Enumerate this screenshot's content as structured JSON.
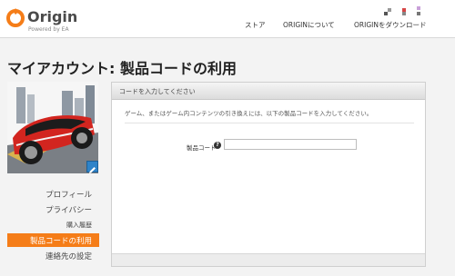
{
  "brand": {
    "name": "Origin",
    "tagline": "Powered by EA"
  },
  "nav": {
    "items": [
      {
        "label": "ストア"
      },
      {
        "label": "ORIGINについて"
      },
      {
        "label": "ORIGINをダウンロード"
      }
    ]
  },
  "page": {
    "title": "マイアカウント: 製品コードの利用"
  },
  "menu": {
    "items": [
      {
        "label": "プロフィール"
      },
      {
        "label": "プライバシー"
      },
      {
        "label": "購入履歴"
      },
      {
        "label": "製品コードの利用"
      },
      {
        "label": "連絡先の設定"
      }
    ]
  },
  "panel": {
    "header": "コードを入力してください",
    "instruction": "ゲーム、またはゲーム内コンテンツの引き換えには、以下の製品コードを入力してください。",
    "code_label": "製品コード",
    "code_value": "",
    "help_glyph": "?"
  },
  "colors": {
    "accent": "#f57d18",
    "edit_button": "#2e83c9"
  }
}
